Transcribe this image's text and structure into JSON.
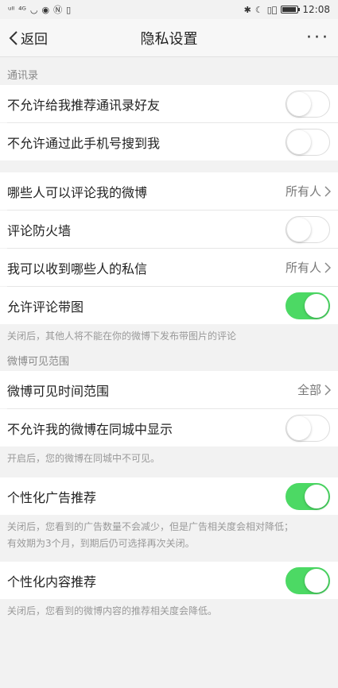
{
  "status_bar": {
    "left_glyphs": [
      "ᵘˡˡ",
      "⁴ᴳ",
      "◡",
      "◉",
      "Ⓝ",
      "▯"
    ],
    "right_glyphs": [
      "✱",
      "☾",
      "▯⃒"
    ],
    "time": "12:08"
  },
  "nav": {
    "back_label": "返回",
    "title": "隐私设置",
    "more": "···"
  },
  "sections": {
    "contacts": "通讯录",
    "weibo_visibility": "微博可见范围"
  },
  "rows": {
    "no_recommend_contacts": {
      "label": "不允许给我推荐通讯录好友",
      "toggle": "off"
    },
    "no_find_by_phone": {
      "label": "不允许通过此手机号搜到我",
      "toggle": "off"
    },
    "who_can_comment": {
      "label": "哪些人可以评论我的微博",
      "value": "所有人"
    },
    "comment_firewall": {
      "label": "评论防火墙",
      "toggle": "off"
    },
    "who_can_message": {
      "label": "我可以收到哪些人的私信",
      "value": "所有人"
    },
    "allow_comment_images": {
      "label": "允许评论带图",
      "toggle": "on"
    },
    "weibo_visible_time": {
      "label": "微博可见时间范围",
      "value": "全部"
    },
    "hide_in_local": {
      "label": "不允许我的微博在同城中显示",
      "toggle": "off"
    },
    "personalized_ads": {
      "label": "个性化广告推荐",
      "toggle": "on"
    },
    "personalized_content": {
      "label": "个性化内容推荐",
      "toggle": "on"
    }
  },
  "notes": {
    "comment_images": "关闭后，其他人将不能在你的微博下发布带图片的评论",
    "local": "开启后，您的微博在同城中不可见。",
    "ads_line1": "关闭后，您看到的广告数量不会减少，但是广告相关度会相对降低；",
    "ads_line2": "有效期为3个月，到期后仍可选择再次关闭。",
    "content": "关闭后，您看到的微博内容的推荐相关度会降低。"
  },
  "colors": {
    "toggle_on": "#4cd964",
    "background": "#f2f2f2"
  },
  "battery_level": 0.95
}
